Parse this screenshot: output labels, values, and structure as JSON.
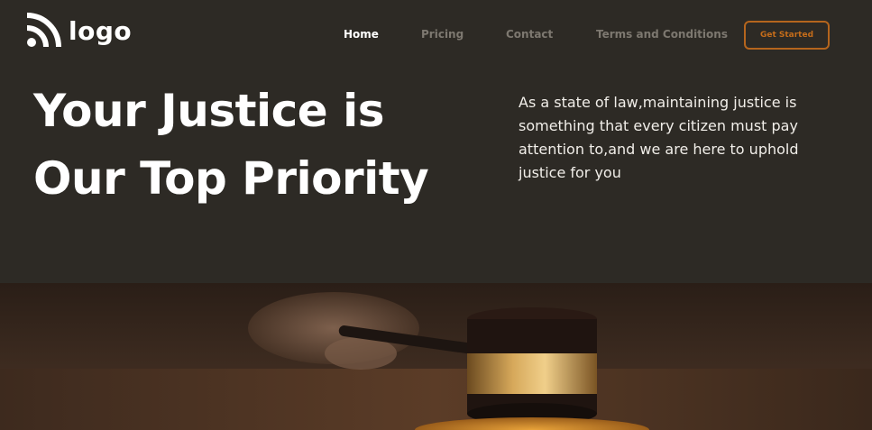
{
  "brand": {
    "logo_text": "logo",
    "logo_icon": "wifi-wave-icon"
  },
  "nav": {
    "items": [
      {
        "label": "Home",
        "active": true
      },
      {
        "label": "Pricing",
        "active": false
      },
      {
        "label": "Contact",
        "active": false
      },
      {
        "label": "Terms and Conditions",
        "active": false
      }
    ],
    "cta_label": "Get Started"
  },
  "hero": {
    "headline": "Your Justice is Our Top Priority",
    "description": "As a state of law,maintaining justice is something that every citizen must pay attention to,and we are here to uphold justice for you",
    "image": "gavel-photo"
  },
  "colors": {
    "background": "#2d2a25",
    "text": "#ffffff",
    "nav_inactive": "#7d7870",
    "accent": "#c46c1a"
  }
}
